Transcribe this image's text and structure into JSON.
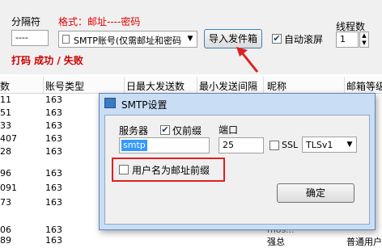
{
  "toolbar": {
    "separator_label": "分隔符",
    "separator_value": "----",
    "format_label": "格式：邮址----密码",
    "account_type_value": "SMTP账号(仅需邮址和密码",
    "import_button": "导入发件箱",
    "auto_scroll_label": "自动滚屏",
    "auto_scroll_checked": true,
    "threads_label": "线程数",
    "threads_value": "1",
    "status_text": "打码 成功 / 失败"
  },
  "table": {
    "headers": [
      "数",
      "账号类型",
      "日最大发送数",
      "最小发送间隔",
      "昵称",
      "邮箱等级"
    ],
    "rows": [
      [
        "11",
        "163",
        "",
        "",
        "",
        ""
      ],
      [
        "51",
        "163",
        "",
        "",
        "",
        ""
      ],
      [
        "33",
        "163",
        "",
        "",
        "",
        ""
      ],
      [
        "407",
        "163",
        "",
        "",
        "",
        ""
      ],
      [
        "28",
        "163",
        "",
        "",
        "",
        ""
      ],
      [
        "96",
        "163",
        "",
        "",
        "",
        ""
      ],
      [
        "091",
        "163",
        "",
        "",
        "",
        ""
      ],
      [
        "73",
        "163",
        "",
        "",
        "",
        ""
      ],
      [
        "",
        "",
        "",
        "",
        "",
        ""
      ],
      [
        "06",
        "163",
        "",
        "",
        "mos...",
        "普..."
      ],
      [
        "89",
        "163",
        "",
        "",
        "强总",
        "普通用户"
      ]
    ]
  },
  "dialog": {
    "title": "SMTP设置",
    "server_label": "服务器",
    "prefix_only_label": "仅前缀",
    "prefix_only_checked": true,
    "server_value": "smtp",
    "port_label": "端口",
    "port_value": "25",
    "ssl_label": "SSL",
    "ssl_checked": false,
    "tls_value": "TLSv1",
    "username_prefix_label": "用户名为邮址前缀",
    "username_prefix_checked": false,
    "ok_button": "确定"
  },
  "colors": {
    "highlight_red": "#e02020",
    "dialog_frame": "#c9def5",
    "selection_blue": "#3399ff"
  }
}
